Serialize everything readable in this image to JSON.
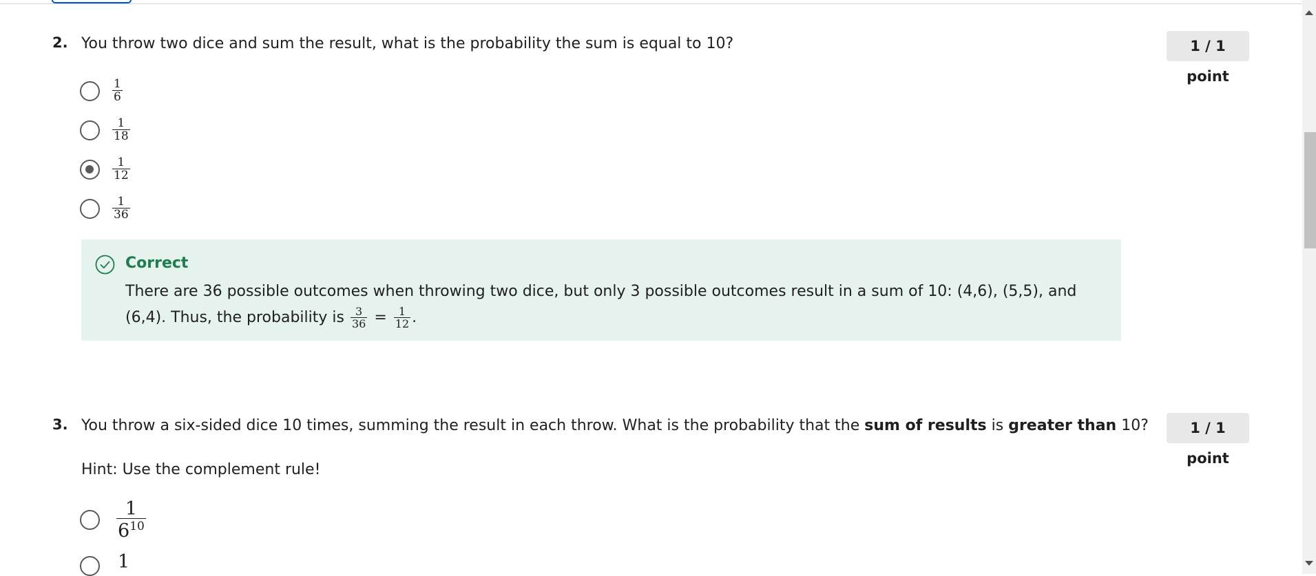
{
  "q2": {
    "number": "2.",
    "text": "You throw two dice and sum the result, what is the probability the sum is equal to 10?",
    "points": "1 / 1 point",
    "options": [
      {
        "num": "1",
        "den": "6",
        "selected": false
      },
      {
        "num": "1",
        "den": "18",
        "selected": false
      },
      {
        "num": "1",
        "den": "12",
        "selected": true
      },
      {
        "num": "1",
        "den": "36",
        "selected": false
      }
    ],
    "feedback": {
      "title": "Correct",
      "text": "There are 36 possible outcomes when throwing two dice, but only 3 possible outcomes result in a sum of 10: (4,6), (5,5), and (6,4). Thus, the probability is",
      "frac1_num": "3",
      "frac1_den": "36",
      "equals": "=",
      "frac2_num": "1",
      "frac2_den": "12",
      "end": "."
    }
  },
  "q3": {
    "number": "3.",
    "text_start": "You throw a six-sided dice 10 times, summing the result in each throw. What is the probability that the",
    "bold1": "sum of results",
    "text_mid": "is",
    "bold2": "greater than",
    "text_end": "10?",
    "points": "1 / 1 point",
    "hint": "Hint: Use the complement rule!",
    "option1": {
      "num": "1",
      "den_base": "6",
      "den_exp": "10"
    },
    "option2": {
      "num": "1"
    }
  },
  "colors": {
    "feedback_bg": "#e6f2ed",
    "correct_green": "#1d7d4c",
    "points_bg": "#e8e8e8"
  },
  "icons": [
    "check-circle-icon",
    "radio-unselected",
    "radio-selected",
    "scroll-up-arrow",
    "scroll-down-arrow"
  ]
}
